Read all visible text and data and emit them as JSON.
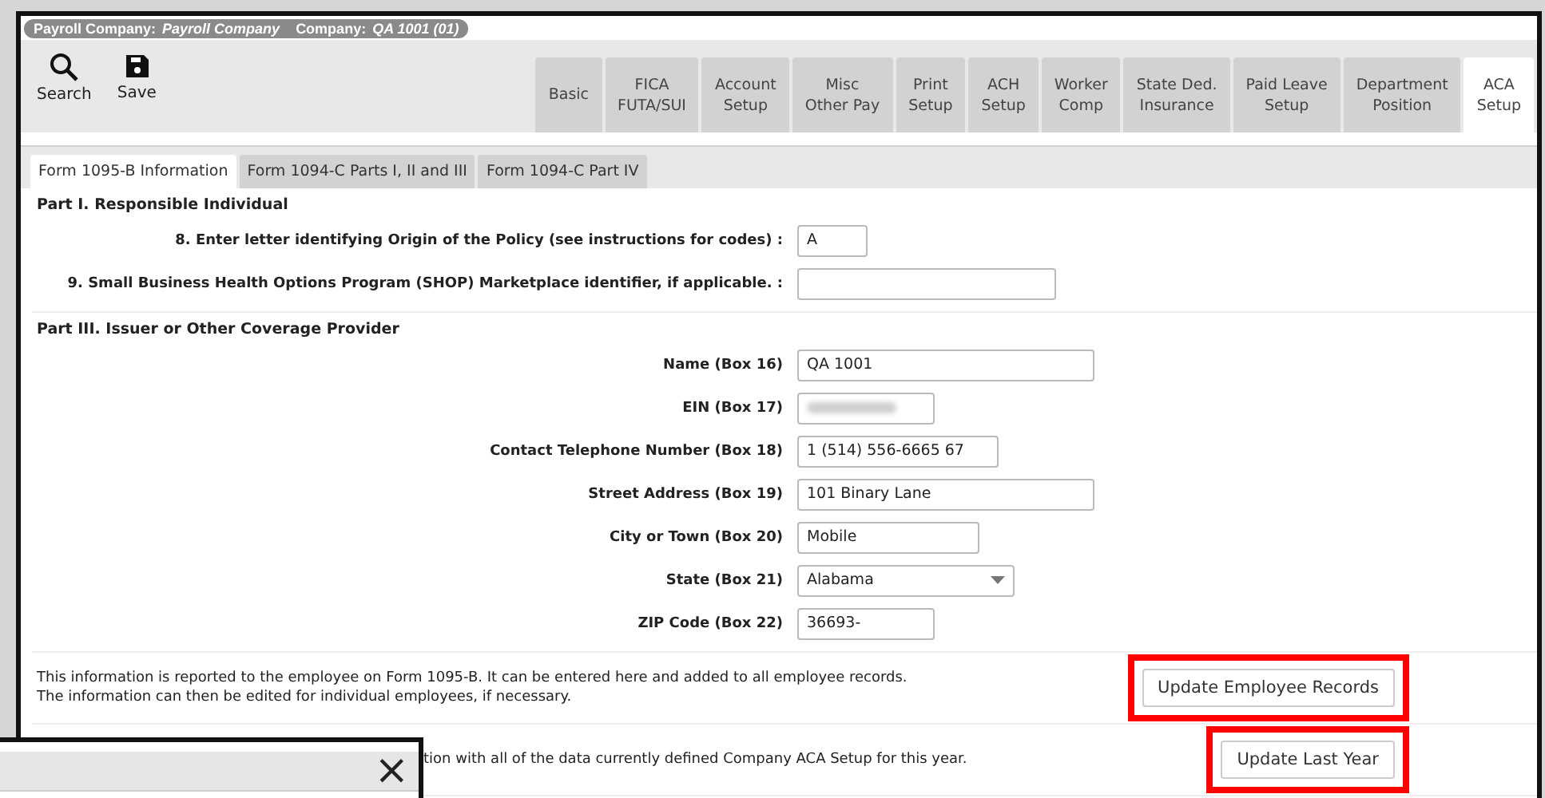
{
  "context_bar": {
    "payroll_label": "Payroll Company:",
    "payroll_value": "Payroll Company",
    "company_label": "Company:",
    "company_value": "QA 1001 (01)"
  },
  "toolbar": [
    {
      "kind": "search",
      "label": "Search"
    },
    {
      "kind": "save",
      "label": "Save"
    }
  ],
  "tabs": [
    {
      "lines": [
        "Basic"
      ],
      "selected": false
    },
    {
      "lines": [
        "FICA",
        "FUTA/SUI"
      ],
      "selected": false
    },
    {
      "lines": [
        "Account",
        "Setup"
      ],
      "selected": false
    },
    {
      "lines": [
        "Misc",
        "Other Pay"
      ],
      "selected": false
    },
    {
      "lines": [
        "Print",
        "Setup"
      ],
      "selected": false
    },
    {
      "lines": [
        "ACH",
        "Setup"
      ],
      "selected": false
    },
    {
      "lines": [
        "Worker",
        "Comp"
      ],
      "selected": false
    },
    {
      "lines": [
        "State Ded.",
        "Insurance"
      ],
      "selected": false
    },
    {
      "lines": [
        "Paid Leave",
        "Setup"
      ],
      "selected": false
    },
    {
      "lines": [
        "Department",
        "Position"
      ],
      "selected": false
    },
    {
      "lines": [
        "ACA",
        "Setup"
      ],
      "selected": true
    }
  ],
  "subtabs": [
    {
      "label": "Form 1095-B Information",
      "selected": true
    },
    {
      "label": "Form 1094-C Parts I, II and III",
      "selected": false
    },
    {
      "label": "Form 1094-C Part IV",
      "selected": false
    }
  ],
  "sections": [
    {
      "title": "Part I. Responsible Individual",
      "fields": [
        {
          "label": "8. Enter letter identifying Origin of the Policy (see instructions for codes) :",
          "kind": "text",
          "value": "A"
        },
        {
          "label": "9. Small Business Health Options Program (SHOP) Marketplace identifier, if applicable. :",
          "kind": "text"
        }
      ]
    },
    {
      "title": "Part III. Issuer or Other Coverage Provider",
      "fields": [
        {
          "label": "Name (Box 16)",
          "kind": "text",
          "value": "QA 1001"
        },
        {
          "label": "EIN (Box 17)",
          "kind": "blurred"
        },
        {
          "label": "Contact Telephone Number (Box 18)",
          "kind": "text",
          "value": "1 (514) 556-6665 67"
        },
        {
          "label": "Street Address (Box 19)",
          "kind": "text",
          "value": "101 Binary Lane"
        },
        {
          "label": "City or Town (Box 20)",
          "kind": "text",
          "value": "Mobile"
        },
        {
          "label": "State (Box 21)",
          "kind": "select",
          "value": "Alabama"
        },
        {
          "label": "ZIP Code (Box 22)",
          "kind": "text",
          "value": "36693-"
        }
      ]
    }
  ],
  "notes": [
    {
      "text": "This information is reported to the employee on Form 1095-B. It can be entered here and added to all employee records.\nThe information can then be edited for individual employees, if necessary.",
      "button": "Update Employee Records",
      "highlighted": true,
      "covered": false
    },
    {
      "text": "tion with all of the data currently defined Company ACA Setup for this year.",
      "button": "Update Last Year",
      "highlighted": true,
      "covered": true
    }
  ],
  "dialog": {
    "close": "×"
  }
}
